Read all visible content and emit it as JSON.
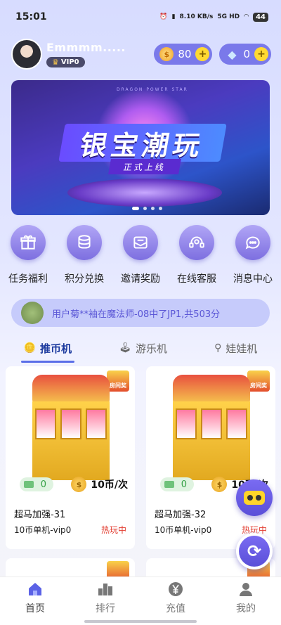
{
  "status": {
    "time": "15:01",
    "speed": "8.10\nKB/s",
    "network": "5G HD",
    "battery": "44"
  },
  "user": {
    "name": "Emmmm.....",
    "vip": "VIP0"
  },
  "wallet": {
    "coins": "80",
    "diamonds": "0"
  },
  "banner": {
    "title": "银宝潮玩",
    "subtitle": "正式上线",
    "tagline": "DRAGON POWER STAR"
  },
  "features": [
    {
      "label": "任务福利",
      "icon": "gift-icon"
    },
    {
      "label": "积分兑换",
      "icon": "coin-stack-icon"
    },
    {
      "label": "邀请奖励",
      "icon": "envelope-icon"
    },
    {
      "label": "在线客服",
      "icon": "headset-icon"
    },
    {
      "label": "消息中心",
      "icon": "chat-icon"
    }
  ],
  "marquee": {
    "text": "用户菊**袖在魔法师-08中了JP1,共503分"
  },
  "tabs": [
    {
      "label": "推币机",
      "icon": "coin-icon",
      "active": true
    },
    {
      "label": "游乐机",
      "icon": "joystick-icon",
      "active": false
    },
    {
      "label": "娃娃机",
      "icon": "claw-icon",
      "active": false
    }
  ],
  "machines": [
    {
      "name": "超马加强-31",
      "mode": "10币单机-vip0",
      "status": "热玩中",
      "credit": "0",
      "price": "10币/次",
      "badge": "房间奖",
      "coin_symbol": "$"
    },
    {
      "name": "超马加强-32",
      "mode": "10币单机-vip0",
      "status": "热玩中",
      "credit": "0",
      "price": "10币/次",
      "badge": "房间奖",
      "coin_symbol": "$"
    }
  ],
  "nav": [
    {
      "label": "首页",
      "icon": "home-icon",
      "active": true
    },
    {
      "label": "排行",
      "icon": "ranking-icon",
      "active": false
    },
    {
      "label": "充值",
      "icon": "yen-icon",
      "active": false
    },
    {
      "label": "我的",
      "icon": "profile-icon",
      "active": false
    }
  ],
  "colors": {
    "accent": "#7a6bf2",
    "hot": "#e23b2e",
    "marquee_text": "#5a56d6"
  }
}
